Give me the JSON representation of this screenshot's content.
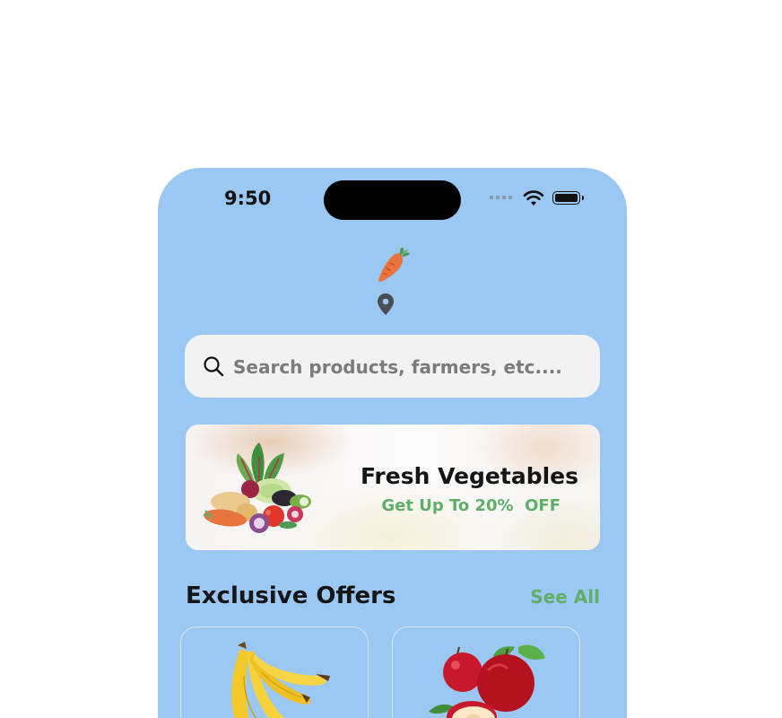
{
  "status_bar": {
    "time": "9:50"
  },
  "header": {
    "logo_icon": "carrot-icon",
    "location_icon": "location-pin-icon"
  },
  "search": {
    "icon": "search-icon",
    "placeholder": "Search products, farmers, etc...."
  },
  "banner": {
    "title": "Fresh Vegetables",
    "subtitle": "Get Up To 20%  OFF"
  },
  "exclusive_offers": {
    "title": "Exclusive Offers",
    "see_all_label": "See All",
    "products": [
      {
        "image": "bananas"
      },
      {
        "image": "red-apples"
      }
    ]
  },
  "colors": {
    "background": "#9bc7f3",
    "accent_green": "#5fae6a",
    "carrot_orange": "#e8743d"
  }
}
